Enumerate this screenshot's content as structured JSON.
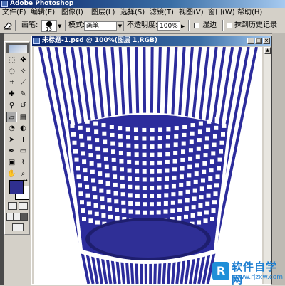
{
  "app": {
    "title": "Adobe Photoshop"
  },
  "menu": {
    "items": [
      "文件(F)",
      "编辑(E)",
      "图像(I)",
      "图层(L)",
      "选择(S)",
      "滤镜(T)",
      "视图(V)",
      "窗口(W)",
      "帮助(H)"
    ]
  },
  "options": {
    "brush_label": "画笔:",
    "brush_size": "13",
    "mode_label": "模式:",
    "mode_value": "画笔",
    "opacity_label": "不透明度:",
    "opacity_value": "100%",
    "wet_edges_label": "湿边",
    "erase_history_label": "抹到历史记录"
  },
  "colors": {
    "foreground": "#2f2f8f",
    "background": "#ffffff",
    "artwork": "#2c2c9c"
  },
  "toolbox": {
    "tools": [
      "marquee-icon",
      "move-icon",
      "lasso-icon",
      "magic-wand-icon",
      "crop-icon",
      "slice-icon",
      "healing-icon",
      "brush-icon",
      "stamp-icon",
      "history-brush-icon",
      "eraser-icon",
      "gradient-icon",
      "blur-icon",
      "dodge-icon",
      "path-select-icon",
      "type-icon",
      "pen-icon",
      "shape-icon",
      "notes-icon",
      "eyedropper-icon",
      "hand-icon",
      "zoom-icon"
    ],
    "type_glyph": "T"
  },
  "document": {
    "title": "未标题-1.psd @ 100%(图层 1,RGB)"
  },
  "watermark": {
    "logo_glyph": "R",
    "name": "软件自学网",
    "url": "www.rjzxw.com"
  }
}
